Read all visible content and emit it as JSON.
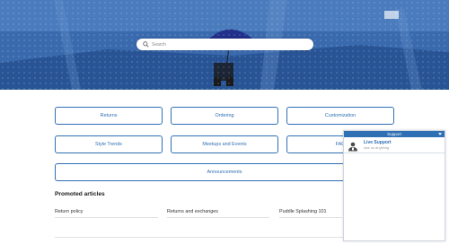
{
  "hero": {
    "search": {
      "placeholder": "Search"
    }
  },
  "categories": [
    {
      "label": "Returns"
    },
    {
      "label": "Ordering"
    },
    {
      "label": "Customization"
    },
    {
      "label": "Style Trends"
    },
    {
      "label": "Meetups and Events"
    },
    {
      "label": "FAQ"
    },
    {
      "label": "Announcements"
    }
  ],
  "promoted": {
    "title": "Promoted articles",
    "articles": [
      {
        "title": "Return policy"
      },
      {
        "title": "Returns and exchanges"
      },
      {
        "title": "Puddle Splashing 101"
      }
    ]
  },
  "support_widget": {
    "header": "Support",
    "agent_name": "Live Support",
    "agent_subtitle": "Ask us anything",
    "accent_color": "#2f6fb3"
  },
  "icons": [
    "search-icon",
    "collapse-icon",
    "support-agent-icon"
  ]
}
